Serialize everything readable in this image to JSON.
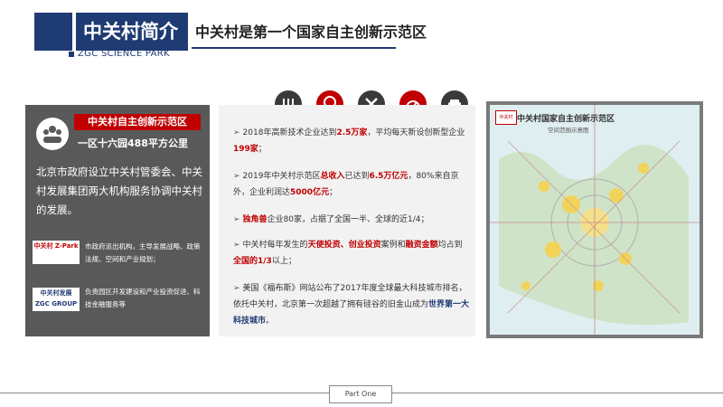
{
  "header": {
    "title": "中关村简介",
    "subtitle_en": "ZGC SCIENCE PARK",
    "main_heading": "中关村是第一个国家自主创新示范区"
  },
  "left_panel": {
    "red_title": "中关村自主创新示范区",
    "sub_title": "一区十六园488平方公里",
    "description": "北京市政府设立中关村管委会、中关村发展集团两大机构服务协调中关村的发展。",
    "org1": {
      "logo_text": "中关村 Z-Park",
      "text": "市政府派出机构，主导发展战略、政策法规、空间和产业规划；"
    },
    "org2": {
      "logo_text": "中关村发展 ZGC GROUP",
      "text": "负责园区开发建设和产业投资促进、科技金融服务等"
    }
  },
  "icons": [
    "gauge-bars-icon",
    "seal-icon",
    "tools-icon",
    "speedometer-icon",
    "car-icon"
  ],
  "bullets": {
    "b1": {
      "p1": "2018年高新技术企业达到",
      "h1": "2.5万家",
      "p2": "，平均每天新设创新型企业",
      "h2": "199家",
      "p3": "；"
    },
    "b2": {
      "p1": "2019年中关村示范区",
      "h1": "总收入",
      "p2": "已达到",
      "h2": "6.5万亿元",
      "p3": "，80%来自京外，企业利润达",
      "h3": "5000亿元",
      "p4": "；"
    },
    "b3": {
      "h1": "独角兽",
      "p1": "企业80家，占据了全国一半、全球的近1/4；"
    },
    "b4": {
      "p1": "中关村每年发生的",
      "h1": "天使投资、创业投资",
      "p2": "案例和",
      "h2": "融资金额",
      "p3": "均占到",
      "h3": "全国的1/3",
      "p4": "以上；"
    },
    "b5": {
      "p1": "美国《福布斯》网站公布了2017年度全球最大科技城市排名，依托中关村，北京第一次超越了拥有硅谷的旧金山成为",
      "h1": "世界第一大科技城市",
      "p2": "。"
    }
  },
  "map": {
    "badge": "中关村",
    "title": "中关村国家自主创新示范区",
    "subtitle": "空间范围示意图"
  },
  "footer": {
    "label": "Part One"
  },
  "colors": {
    "navy": "#1f3b73",
    "red": "#c00000",
    "gray_panel": "#595959"
  }
}
